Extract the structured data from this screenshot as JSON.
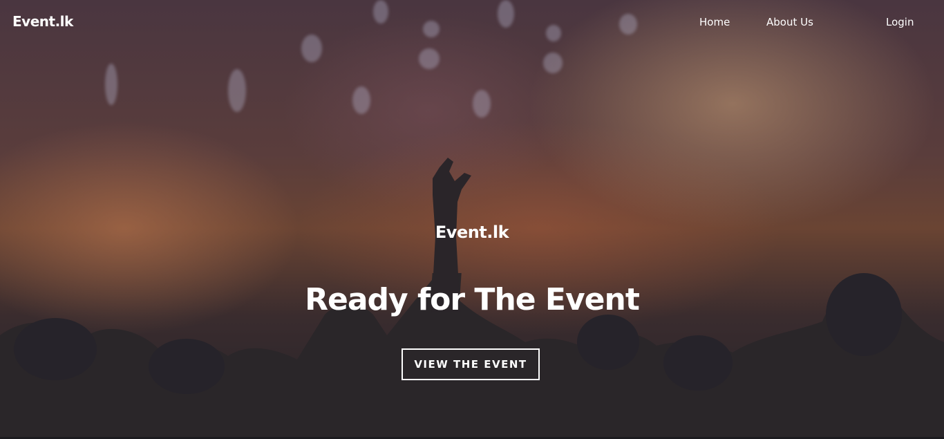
{
  "navbar": {
    "brand": "Event.lk",
    "links": [
      {
        "label": "Home"
      },
      {
        "label": "About Us"
      },
      {
        "label": "Login"
      }
    ]
  },
  "hero": {
    "subtitle": "Event.lk",
    "title": "Ready for The Event",
    "cta_label": "VIEW THE EVENT",
    "background": "concert-crowd-photo"
  },
  "colors": {
    "text": "#ffffff",
    "overlay": "#25232a",
    "accent_warm": "#6a4433"
  }
}
